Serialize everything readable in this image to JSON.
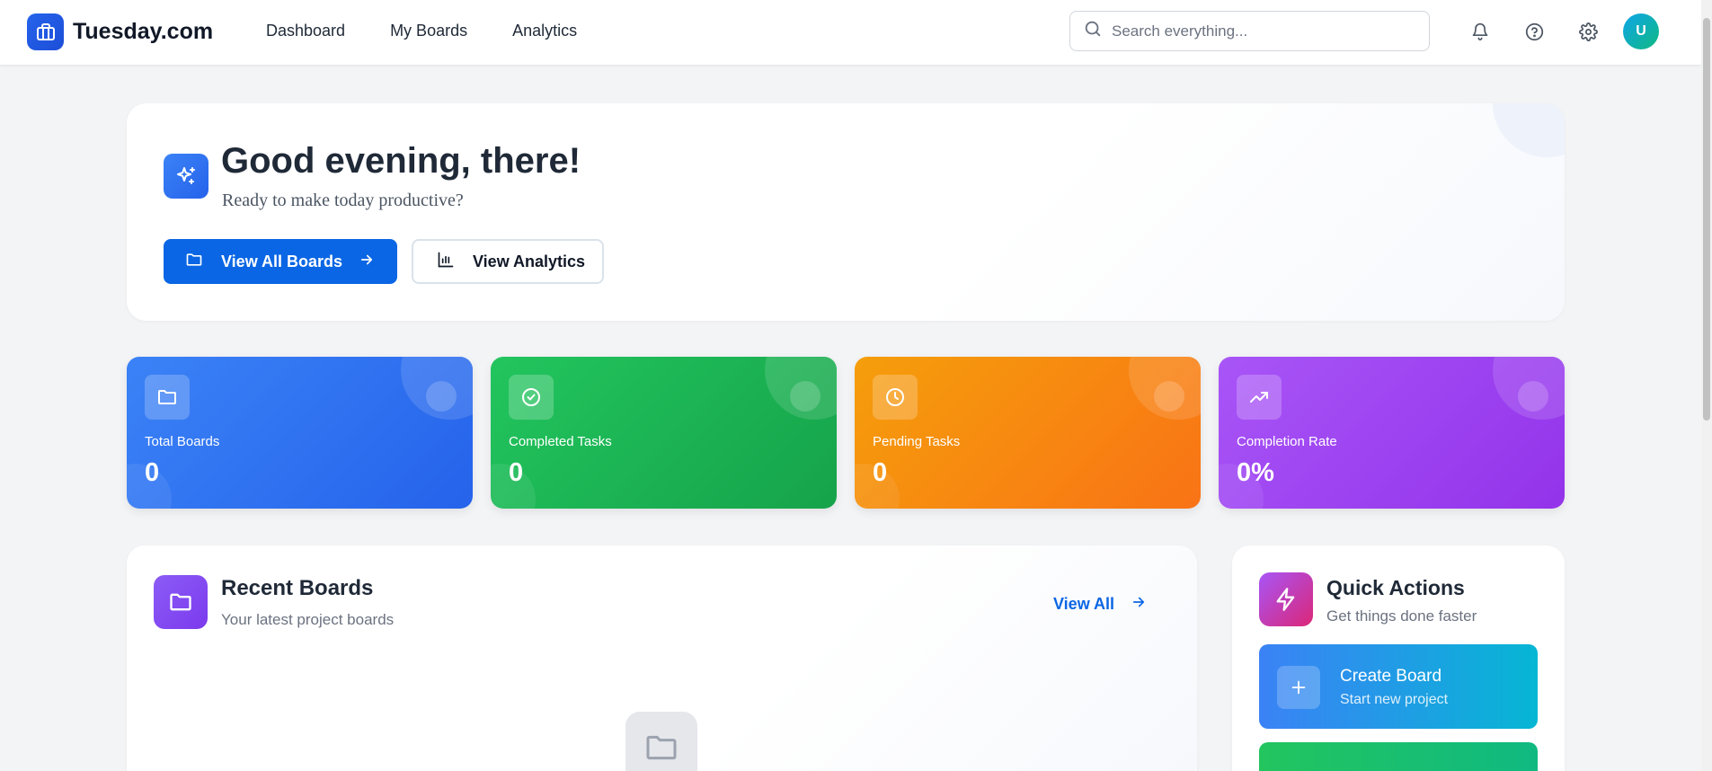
{
  "brand": {
    "name": "Tuesday.com"
  },
  "nav": {
    "links": [
      {
        "label": "Dashboard"
      },
      {
        "label": "My Boards"
      },
      {
        "label": "Analytics"
      }
    ],
    "search_placeholder": "Search everything...",
    "avatar_initial": "U"
  },
  "hero": {
    "title": "Good evening, there!",
    "subtitle": "Ready to make today productive?",
    "primary_button": "View All Boards",
    "secondary_button": "View Analytics"
  },
  "stats": [
    {
      "label": "Total Boards",
      "value": "0",
      "color": "#3b82f6",
      "icon": "folder-icon"
    },
    {
      "label": "Completed Tasks",
      "value": "0",
      "color": "#22c55e",
      "icon": "check-circle-icon"
    },
    {
      "label": "Pending Tasks",
      "value": "0",
      "color": "#f59e0b",
      "icon": "clock-icon"
    },
    {
      "label": "Completion Rate",
      "value": "0%",
      "color": "#a855f7",
      "icon": "trending-up-icon"
    }
  ],
  "recent": {
    "title": "Recent Boards",
    "subtitle": "Your latest project boards",
    "view_all": "View All"
  },
  "quick": {
    "title": "Quick Actions",
    "subtitle": "Get things done faster",
    "create": {
      "title": "Create Board",
      "subtitle": "Start new project"
    }
  }
}
